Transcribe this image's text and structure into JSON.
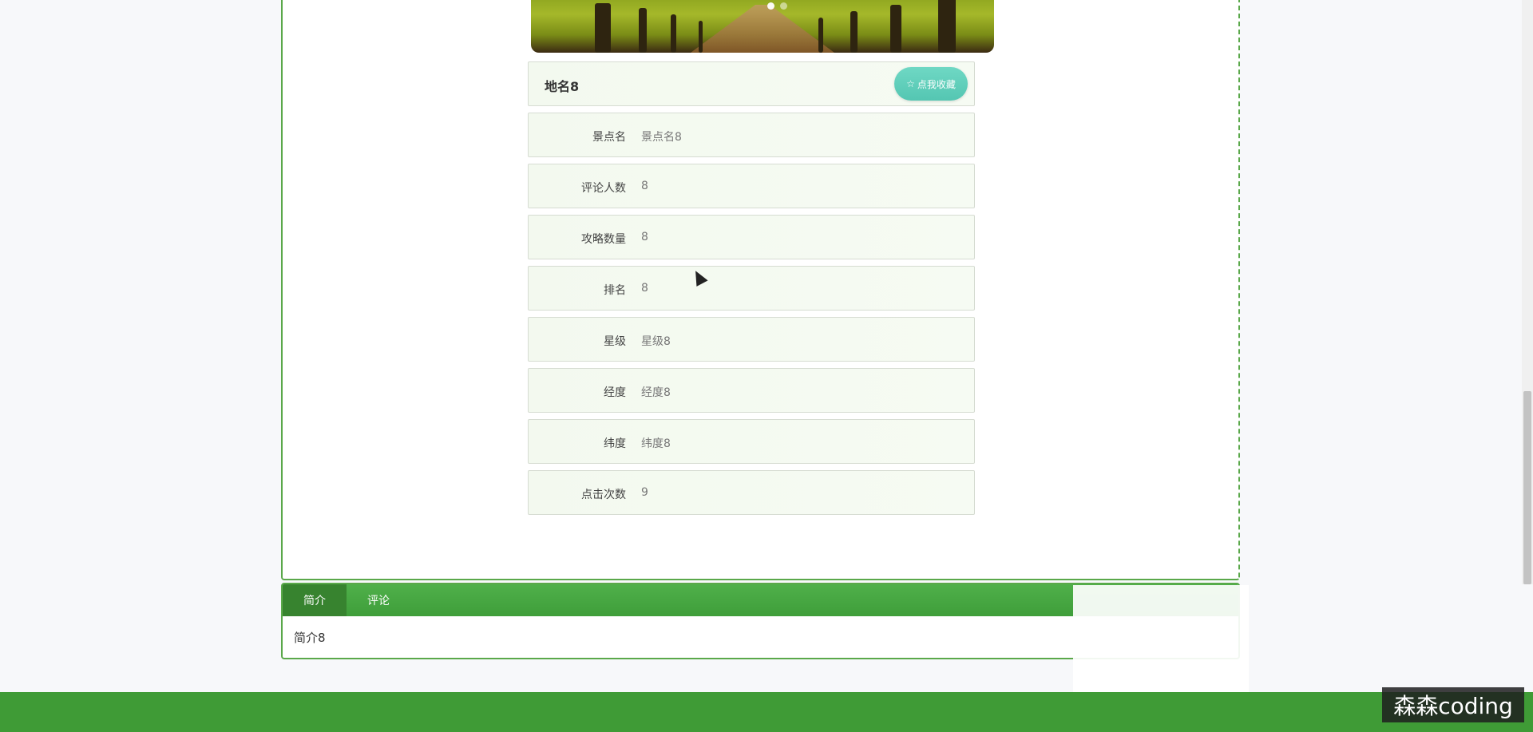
{
  "detail": {
    "title": "地名8",
    "favorite_button": {
      "icon": "star-icon",
      "label": "点我收藏"
    },
    "fields": [
      {
        "label": "景点名",
        "value": "景点名8"
      },
      {
        "label": "评论人数",
        "value": "8"
      },
      {
        "label": "攻略数量",
        "value": "8"
      },
      {
        "label": "排名",
        "value": "8"
      },
      {
        "label": "星级",
        "value": "星级8"
      },
      {
        "label": "经度",
        "value": "经度8"
      },
      {
        "label": "纬度",
        "value": "纬度8"
      },
      {
        "label": "点击次数",
        "value": "9"
      }
    ]
  },
  "tabs": {
    "items": [
      {
        "label": "简介",
        "active": true
      },
      {
        "label": "评论",
        "active": false
      }
    ],
    "content": "简介8"
  },
  "watermark": "森森coding",
  "colors": {
    "primary_green": "#3f9e3a",
    "accent_teal": "#54c6b2",
    "field_background": "#f3f9ef"
  }
}
